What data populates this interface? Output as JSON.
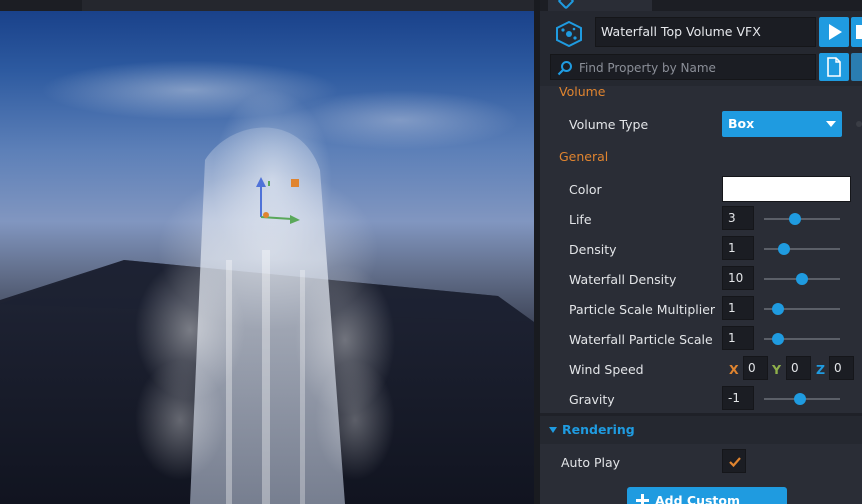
{
  "window": {
    "object_name": "Waterfall Top Volume VFX"
  },
  "search": {
    "placeholder": "Find Property by Name"
  },
  "sections": {
    "volume": "Volume",
    "general": "General",
    "rendering": "Rendering"
  },
  "properties": {
    "volume_type": {
      "label": "Volume Type",
      "value": "Box"
    },
    "color": {
      "label": "Color",
      "value": "#ffffff"
    },
    "life": {
      "label": "Life",
      "value": "3",
      "slider": 0.41
    },
    "density": {
      "label": "Density",
      "value": "1",
      "slider": 0.26
    },
    "waterfall_density": {
      "label": "Waterfall Density",
      "value": "10",
      "slider": 0.5
    },
    "particle_scale_multiplier": {
      "label": "Particle Scale Multiplier",
      "value": "1",
      "slider": 0.18
    },
    "waterfall_particle_scale": {
      "label": "Waterfall Particle Scale",
      "value": "1",
      "slider": 0.18
    },
    "wind_speed": {
      "label": "Wind Speed",
      "x_label": "X",
      "x": "0",
      "y_label": "Y",
      "y": "0",
      "z_label": "Z",
      "z": "0"
    },
    "gravity": {
      "label": "Gravity",
      "value": "-1",
      "slider": 0.47
    },
    "auto_play": {
      "label": "Auto Play",
      "checked": true
    }
  },
  "buttons": {
    "add_custom_property": "Add Custom Property"
  },
  "colors": {
    "accent": "#1f9be0",
    "section_orange": "#e0842f",
    "panel_bg": "#2a2d36",
    "axis_x": "#e0842f",
    "axis_y": "#8fb04a",
    "axis_z": "#1f9be0"
  },
  "icons": [
    "vfx-icon",
    "play-icon",
    "stop-icon",
    "search-icon",
    "document-icon",
    "chevron-down-icon",
    "checkmark-icon",
    "plus-icon",
    "transform-gizmo-icon"
  ]
}
